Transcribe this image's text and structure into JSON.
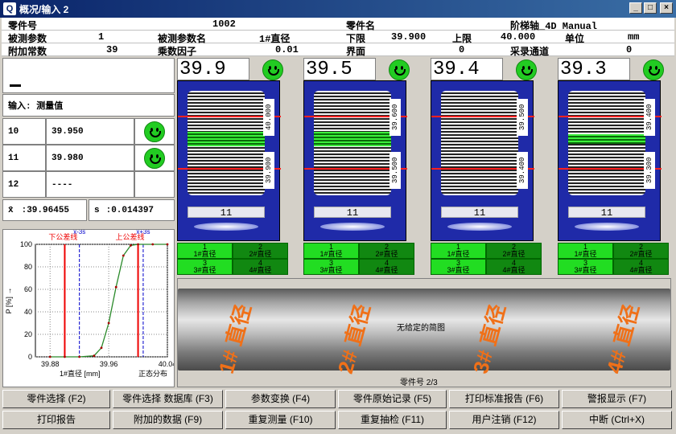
{
  "window": {
    "title": "概况/输入 2",
    "min": "_",
    "max": "□",
    "close": "×"
  },
  "info": {
    "part_no_label": "零件号",
    "part_no": "1002",
    "part_name_label": "零件名",
    "part_name": "阶梯轴_4D Manual",
    "param_label": "被测参数",
    "param": "1",
    "param_name_label": "被测参数名",
    "param_name": "1#直径",
    "lower_label": "下限",
    "lower": "39.900",
    "upper_label": "上限",
    "upper": "40.000",
    "unit_label": "单位",
    "unit": "mm",
    "const_label": "附加常数",
    "const": "39",
    "factor_label": "乘数因子",
    "factor": "0.01",
    "iface_label": "界面",
    "iface": "0",
    "channel_label": "采录通道",
    "channel": "0"
  },
  "input": {
    "header": "输入: 测量值",
    "rows": [
      {
        "idx": "10",
        "value": "39.950",
        "ok": true
      },
      {
        "idx": "11",
        "value": "39.980",
        "ok": true
      },
      {
        "idx": "12",
        "value": "----",
        "ok": false
      }
    ],
    "mean_label": "x̄",
    "mean": ":39.96455",
    "sd_label": "s",
    "sd": ":0.014397"
  },
  "gauges": [
    {
      "value": "39.9",
      "upper": "40.000",
      "lower": "39.900",
      "num": "11",
      "band": 0.45
    },
    {
      "value": "39.5",
      "upper": "39.600",
      "lower": "39.500",
      "num": "11",
      "band": 0.45
    },
    {
      "value": "39.4",
      "upper": "39.500",
      "lower": "39.400",
      "num": "11",
      "band": 0.0
    },
    {
      "value": "39.3",
      "upper": "39.400",
      "lower": "39.300",
      "num": "11",
      "band": 0.3
    }
  ],
  "tiles": [
    [
      "1",
      "1#直径"
    ],
    [
      "2",
      "2#直径"
    ],
    [
      "3",
      "3#直径"
    ],
    [
      "4",
      "4#直径"
    ]
  ],
  "image": {
    "caption": "无给定的简图",
    "footer": "零件号 2/3",
    "labels": [
      "1# 直径",
      "2# 直径",
      "3# 直径",
      "4# 直径"
    ]
  },
  "chart_data": {
    "type": "line",
    "title": "",
    "ylabel": "P [%] →",
    "xlabel": "1#直径 [mm]",
    "xnote": "正态分布",
    "ylim": [
      0,
      100
    ],
    "xlim": [
      39.86,
      40.04
    ],
    "xticks": [
      "39.88",
      "39.96",
      "40.04"
    ],
    "yticks": [
      "0",
      "20",
      "40",
      "60",
      "80",
      "100"
    ],
    "annotations": {
      "lower_limit": "下公差线",
      "upper_limit": "上公差线",
      "minus3s": "x̄-3s",
      "plus3s": "x̄+3s"
    },
    "x": [
      39.88,
      39.9,
      39.92,
      39.94,
      39.95,
      39.96,
      39.97,
      39.98,
      39.99,
      40.0,
      40.02,
      40.04
    ],
    "y": [
      0,
      0,
      0,
      1,
      8,
      30,
      62,
      90,
      99,
      100,
      100,
      100
    ],
    "limits": {
      "lsl": 39.9,
      "usl": 40.0,
      "m3s": 39.92,
      "p3s": 40.007
    }
  },
  "buttons": [
    [
      "零件选择 (F2)",
      "零件选择 数据库 (F3)",
      "参数变换 (F4)",
      "零件原始记录 (F5)",
      "打印标准报告 (F6)",
      "警报显示 (F7)"
    ],
    [
      "打印报告",
      "附加的数据 (F9)",
      "重复测量 (F10)",
      "重复抽检 (F11)",
      "用户注销 (F12)",
      "中断 (Ctrl+X)"
    ]
  ]
}
